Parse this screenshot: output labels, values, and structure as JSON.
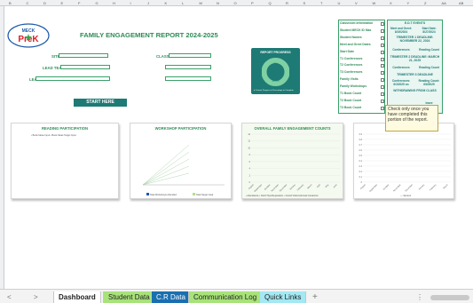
{
  "columns": [
    "B",
    "C",
    "D",
    "E",
    "F",
    "G",
    "H",
    "I",
    "J",
    "K",
    "L",
    "M",
    "N",
    "O",
    "P",
    "Q",
    "R",
    "S",
    "T",
    "U",
    "V",
    "W",
    "X",
    "Y",
    "Z",
    "AA",
    "AB"
  ],
  "logo": {
    "line1": "MECK",
    "line2": "PreK",
    "icon": "star-logo-icon"
  },
  "header": {
    "title": "FAMILY ENGAGEMENT REPORT 2024-2025"
  },
  "fields": {
    "site_name": "SITE NAME",
    "classroom_number": "CLASSROOM NUMBER",
    "lead_teacher_name": "LEAD TEACHER NAME",
    "ta_name": "T.A NAME",
    "lead_teacher_email": "LEAD TEACHER MECK EMAIL",
    "ta_email": "T.A MECK EMAIL"
  },
  "start_button": "START HERE",
  "report_progress": {
    "title": "REPORT PROGRESS",
    "completed_label": "0%",
    "remaining_label": "100%",
    "completed_pct": 0,
    "legend": "● Current Progress   ● Percentage to Complete",
    "colors": {
      "ring": "#7fd1a4",
      "inner": "#1e7a74"
    }
  },
  "charts": {
    "reading": {
      "title": "READING PARTICIPATION",
      "legend": "▪ Book Ideas Input  ▪ Book Ideas Target Input"
    },
    "workshop": {
      "title": "WORKSHOP PARTICIPATION",
      "legend1": "Total Workshops Attended",
      "legend2": "Total Target Goal"
    },
    "overall": {
      "title": "OVERALL FAMILY ENGAGEMENT COUNTS",
      "y_ticks": [
        "14",
        "12",
        "10",
        "8",
        "6",
        "4",
        "2",
        "0"
      ],
      "x_labels": [
        "August",
        "September",
        "October",
        "November",
        "December",
        "January",
        "February",
        "March",
        "April",
        "May",
        "June"
      ],
      "legend": "▪ Attendance  ▪ Field Trips/Separation  ▪ Grand Visitors/Actual Interaction"
    },
    "class": {
      "title": "CLASS",
      "y_ticks": [
        "0.9",
        "0.8",
        "0.7",
        "0.6",
        "0.5",
        "0.4",
        "0.3",
        "0.2",
        "0.1",
        "0"
      ],
      "x_labels": [
        "August",
        "September",
        "October",
        "November",
        "December",
        "January",
        "February",
        "March"
      ],
      "legend": "— Series1"
    }
  },
  "checklist": {
    "items": [
      "Classroom Information",
      "Student MECK ID Max",
      "Student Names",
      "Meet and Greet Dates",
      "Start Date",
      "T1 Conferences",
      "T2 Conferences",
      "T3 Conferences",
      "Family Visits",
      "Family Workshops",
      "T1 Book Count",
      "T2 Book Count",
      "T3 Book Count"
    ]
  },
  "events": {
    "title": "E.D.T EVENTS",
    "meet_greet": "Meet and Greet:",
    "meet_greet_date": "8/19/2024",
    "start_date_label": "Start Date:",
    "start_date": "8/27/2024",
    "t1_deadline": "TRIMESTER 1 DEADLINE: NOVEMBER 22, 2024",
    "conferences": "Conferences",
    "reading_count": "Reading Count",
    "t2_deadline": "TRIMESTER 2 DEADLINE: MARCH 21, 2025",
    "t3_deadline": "TRIMESTER 3 DEADLINE",
    "conf_date": "Conferences: 6/3/2025 on",
    "reading_date": "Reading Count: 6/6/2025",
    "withdraw": "WITHDRAWING FROM CLASS",
    "leave": "leave"
  },
  "tooltip": "Check only once you have completed this portion of the report.",
  "tabs": [
    {
      "label": "Dashboard",
      "bg": "#ffffff",
      "color": "#222"
    },
    {
      "label": "Student Data",
      "bg": "#a8e27a",
      "color": "#222"
    },
    {
      "label": "C.R Data",
      "bg": "#1a6fb0",
      "color": "#ffffff"
    },
    {
      "label": "Communication Log",
      "bg": "#a8e27a",
      "color": "#222"
    },
    {
      "label": "Quick Links",
      "bg": "#a3e8f2",
      "color": "#222"
    }
  ],
  "add_sheet": "+",
  "nav": {
    "prev": "<",
    "next": ">",
    "more": "⋮"
  }
}
